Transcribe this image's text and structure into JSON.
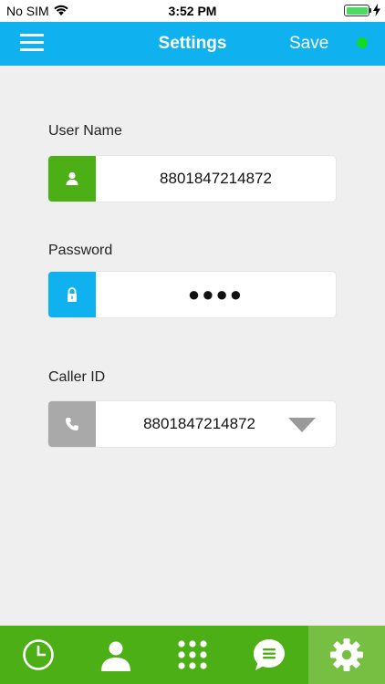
{
  "status_bar": {
    "carrier": "No SIM",
    "time": "3:52 PM",
    "wifi_icon": "wifi-icon",
    "battery_icon": "battery-charging-icon"
  },
  "header": {
    "menu_icon": "hamburger-menu-icon",
    "title": "Settings",
    "save_label": "Save",
    "status_color": "#11d926"
  },
  "form": {
    "username": {
      "label": "User Name",
      "value": "8801847214872",
      "icon": "user-icon",
      "icon_color": "#4caf16"
    },
    "password": {
      "label": "Password",
      "value": "●●●●",
      "icon": "lock-icon",
      "icon_color": "#0fb2ef"
    },
    "caller_id": {
      "label": "Caller ID",
      "value": "8801847214872",
      "icon": "phone-icon",
      "icon_color": "#a9a9a9",
      "dropdown_icon": "dropdown-triangle-icon"
    }
  },
  "tab_bar": {
    "tabs": [
      {
        "name": "recents",
        "icon": "clock-icon",
        "active": false
      },
      {
        "name": "contacts",
        "icon": "contact-person-icon",
        "active": false
      },
      {
        "name": "dialpad",
        "icon": "dialpad-icon",
        "active": false
      },
      {
        "name": "messages",
        "icon": "chat-bubble-icon",
        "active": false
      },
      {
        "name": "settings",
        "icon": "gear-icon",
        "active": true
      }
    ],
    "background_color": "#4caf16",
    "active_color": "#76bf43"
  }
}
